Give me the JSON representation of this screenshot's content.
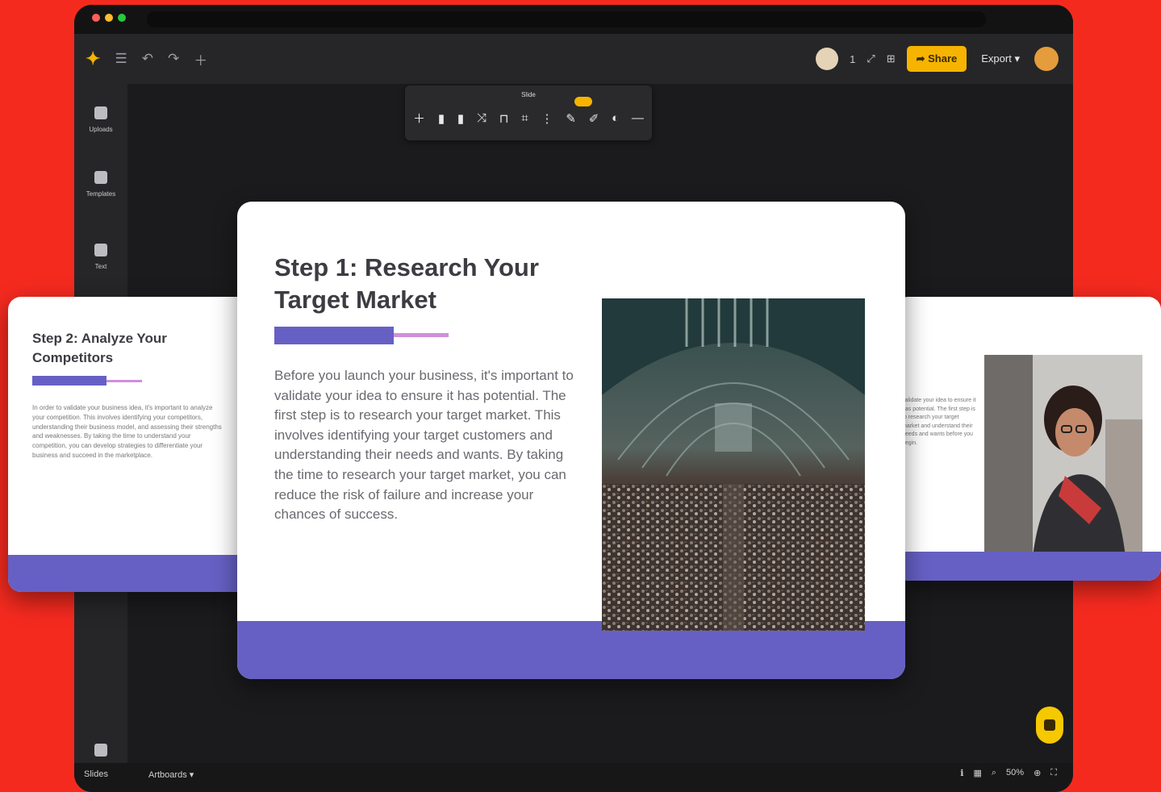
{
  "colors": {
    "background": "#f52a1f",
    "accent": "#f6b400",
    "slide_band": "#6660c4",
    "slide_bar_light": "#cf8fda",
    "window_bg": "#1c1c1e"
  },
  "header": {
    "share_label": "Share",
    "export_label": "Export",
    "collaborator_count": "1",
    "icons": [
      "logo-icon",
      "menu-icon",
      "undo-icon",
      "redo-icon",
      "add-icon",
      "collaborator-avatar",
      "fullscreen-icon",
      "layout-icon",
      "user-avatar"
    ]
  },
  "sidebar": {
    "items": [
      {
        "label": "Uploads",
        "icon": "folder-icon"
      },
      {
        "label": "Templates",
        "icon": "template-icon"
      },
      {
        "label": "Text",
        "icon": "text-icon"
      }
    ],
    "bottom_item": {
      "label": "Slides",
      "icon": "slides-icon"
    }
  },
  "float_toolbar": {
    "title": "Slide",
    "icons": [
      "add-slide-icon",
      "copy-icon",
      "paste-icon",
      "shuffle-icon",
      "lock-icon",
      "crop-icon",
      "more-icon",
      "edit-icon",
      "magic-icon",
      "color-icon",
      "delete-icon"
    ]
  },
  "slides": {
    "main": {
      "title": "Step 1: Research Your Target Market",
      "body": "Before you launch your business, it's important to validate your idea to ensure it has potential. The first step is to research your target market. This involves identifying your target customers and understanding their needs and wants. By taking the time to research your target market, you can reduce the risk of failure and increase your chances of success."
    },
    "left": {
      "title": "Step 2: Analyze Your Competitors",
      "body": "In order to validate your business idea, it's important to analyze your competition. This involves identifying your competitors, understanding their business model, and assessing their strengths and weaknesses. By taking the time to understand your competition, you can develop strategies to differentiate your business and succeed in the marketplace."
    },
    "right": {
      "body": "validate your idea to ensure it has potential. The first step is to research your target market and understand their needs and wants before you begin."
    }
  },
  "bottom_bar": {
    "left_label": "Slides",
    "artboard_label": "Artboards",
    "zoom_label": "50%"
  }
}
